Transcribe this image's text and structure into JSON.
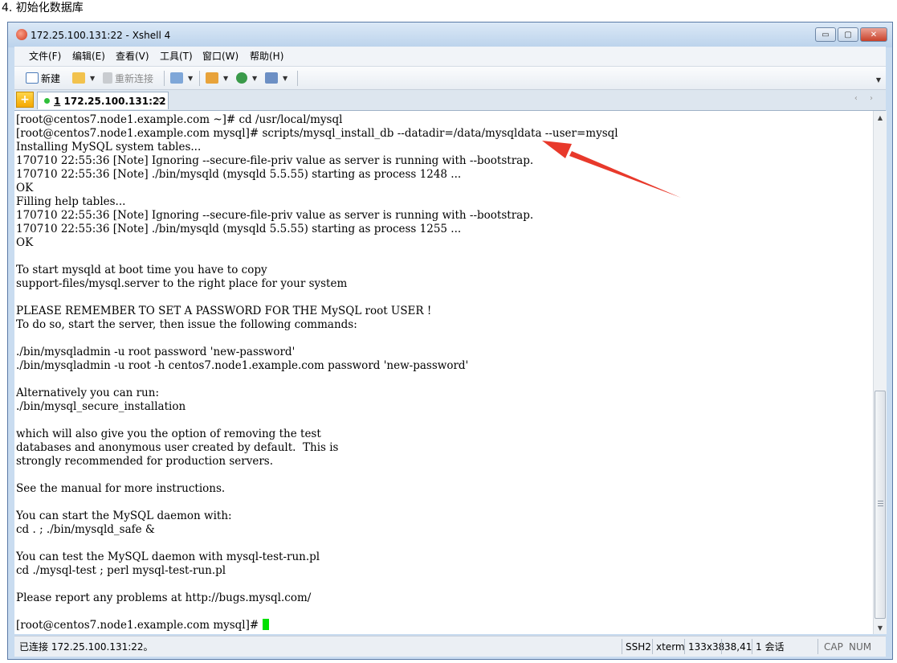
{
  "doc_heading": "4. 初始化数据库",
  "window": {
    "title": "172.25.100.131:22 - Xshell 4",
    "controls": {
      "minimize": "▭",
      "maximize": "▢",
      "close": "✕"
    }
  },
  "menu": [
    "文件(F)",
    "编辑(E)",
    "查看(V)",
    "工具(T)",
    "窗口(W)",
    "帮助(H)"
  ],
  "toolbar": {
    "new_label": "新建",
    "reconnect_label": "重新连接",
    "icons": [
      "new-session-icon",
      "open-folder-icon",
      "reconnect-icon",
      "properties-icon",
      "transfer-icon",
      "globe-icon",
      "font-icon"
    ]
  },
  "tab": {
    "number": "1",
    "host": "172.25.100.131:22",
    "close": "×",
    "add": "+"
  },
  "terminal": {
    "lines": [
      "[root@centos7.node1.example.com ~]# cd /usr/local/mysql",
      "[root@centos7.node1.example.com mysql]# scripts/mysql_install_db --datadir=/data/mysqldata --user=mysql",
      "Installing MySQL system tables...",
      "170710 22:55:36 [Note] Ignoring --secure-file-priv value as server is running with --bootstrap.",
      "170710 22:55:36 [Note] ./bin/mysqld (mysqld 5.5.55) starting as process 1248 ...",
      "OK",
      "Filling help tables...",
      "170710 22:55:36 [Note] Ignoring --secure-file-priv value as server is running with --bootstrap.",
      "170710 22:55:36 [Note] ./bin/mysqld (mysqld 5.5.55) starting as process 1255 ...",
      "OK",
      "",
      "To start mysqld at boot time you have to copy",
      "support-files/mysql.server to the right place for your system",
      "",
      "PLEASE REMEMBER TO SET A PASSWORD FOR THE MySQL root USER !",
      "To do so, start the server, then issue the following commands:",
      "",
      "./bin/mysqladmin -u root password 'new-password'",
      "./bin/mysqladmin -u root -h centos7.node1.example.com password 'new-password'",
      "",
      "Alternatively you can run:",
      "./bin/mysql_secure_installation",
      "",
      "which will also give you the option of removing the test",
      "databases and anonymous user created by default.  This is",
      "strongly recommended for production servers.",
      "",
      "See the manual for more instructions.",
      "",
      "You can start the MySQL daemon with:",
      "cd . ; ./bin/mysqld_safe &",
      "",
      "You can test the MySQL daemon with mysql-test-run.pl",
      "cd ./mysql-test ; perl mysql-test-run.pl",
      "",
      "Please report any problems at http://bugs.mysql.com/",
      ""
    ],
    "prompt": "[root@centos7.node1.example.com mysql]# ",
    "cursor_color": "#00e000"
  },
  "status": {
    "connection": "已连接 172.25.100.131:22。",
    "protocol": "SSH2",
    "terminal_type": "xterm",
    "size": "133x38",
    "cursor_pos": "38,41",
    "sessions": "1 会话",
    "caps": "CAP",
    "num": "NUM"
  },
  "annotation": {
    "arrow_color": "#e8392b"
  }
}
